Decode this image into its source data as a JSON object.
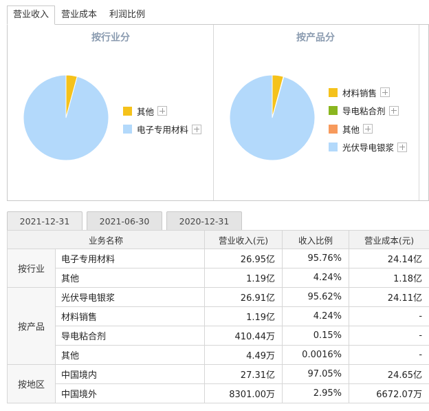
{
  "top_tabs": [
    {
      "label": "营业收入",
      "active": true
    },
    {
      "label": "营业成本",
      "active": false
    },
    {
      "label": "利润比例",
      "active": false
    }
  ],
  "charts": [
    {
      "title": "按行业分",
      "legend": [
        {
          "name": "其他",
          "color": "#f5c21b"
        },
        {
          "name": "电子专用材料",
          "color": "#b3d9fb"
        }
      ]
    },
    {
      "title": "按产品分",
      "legend": [
        {
          "name": "材料销售",
          "color": "#f5c21b"
        },
        {
          "name": "导电粘合剂",
          "color": "#8ab61f"
        },
        {
          "name": "其他",
          "color": "#f79a5c"
        },
        {
          "name": "光伏导电银浆",
          "color": "#b3d9fb"
        }
      ]
    }
  ],
  "chart_data": [
    {
      "type": "pie",
      "title": "按行业分",
      "labels": [
        "其他",
        "电子专用材料"
      ],
      "values": [
        4.24,
        95.76
      ],
      "colors": [
        "#f5c21b",
        "#b3d9fb"
      ]
    },
    {
      "type": "pie",
      "title": "按产品分",
      "labels": [
        "材料销售",
        "导电粘合剂",
        "其他",
        "光伏导电银浆"
      ],
      "values": [
        4.24,
        0.15,
        0.0016,
        95.62
      ],
      "colors": [
        "#f5c21b",
        "#8ab61f",
        "#f79a5c",
        "#b3d9fb"
      ]
    }
  ],
  "date_tabs": [
    {
      "label": "2021-12-31",
      "active": true
    },
    {
      "label": "2021-06-30",
      "active": false
    },
    {
      "label": "2020-12-31",
      "active": false
    }
  ],
  "table": {
    "headers": [
      "业务名称",
      "营业收入(元)",
      "收入比例",
      "营业成本(元)"
    ],
    "groups": [
      {
        "label": "按行业",
        "rows": [
          {
            "name": "电子专用材料",
            "revenue": "26.95亿",
            "ratio": "95.76%",
            "cost": "24.14亿"
          },
          {
            "name": "其他",
            "revenue": "1.19亿",
            "ratio": "4.24%",
            "cost": "1.18亿"
          }
        ]
      },
      {
        "label": "按产品",
        "rows": [
          {
            "name": "光伏导电银浆",
            "revenue": "26.91亿",
            "ratio": "95.62%",
            "cost": "24.11亿"
          },
          {
            "name": "材料销售",
            "revenue": "1.19亿",
            "ratio": "4.24%",
            "cost": "-"
          },
          {
            "name": "导电粘合剂",
            "revenue": "410.44万",
            "ratio": "0.15%",
            "cost": "-"
          },
          {
            "name": "其他",
            "revenue": "4.49万",
            "ratio": "0.0016%",
            "cost": "-"
          }
        ]
      },
      {
        "label": "按地区",
        "rows": [
          {
            "name": "中国境内",
            "revenue": "27.31亿",
            "ratio": "97.05%",
            "cost": "24.65亿"
          },
          {
            "name": "中国境外",
            "revenue": "8301.00万",
            "ratio": "2.95%",
            "cost": "6672.07万"
          }
        ]
      }
    ]
  }
}
